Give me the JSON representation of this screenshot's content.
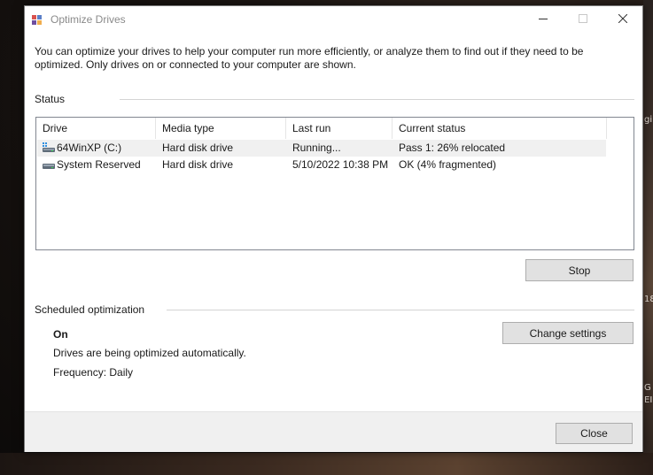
{
  "window": {
    "title": "Optimize Drives"
  },
  "description": "You can optimize your drives to help your computer run more efficiently, or analyze them to find out if they need to be optimized. Only drives on or connected to your computer are shown.",
  "status": {
    "section_label": "Status",
    "columns": [
      "Drive",
      "Media type",
      "Last run",
      "Current status"
    ],
    "rows": [
      {
        "drive": "64WinXP  (C:)",
        "icon": "windows-drive-icon",
        "media_type": "Hard disk drive",
        "last_run": "Running...",
        "current_status": "Pass 1: 26% relocated",
        "selected": true
      },
      {
        "drive": "System Reserved",
        "icon": "hard-drive-icon",
        "media_type": "Hard disk drive",
        "last_run": "5/10/2022 10:38 PM",
        "current_status": "OK (4% fragmented)",
        "selected": false
      }
    ],
    "stop_label": "Stop"
  },
  "scheduled": {
    "section_label": "Scheduled optimization",
    "state": "On",
    "message": "Drives are being optimized automatically.",
    "frequency": "Frequency: Daily",
    "change_label": "Change settings"
  },
  "footer": {
    "close_label": "Close"
  },
  "desktop": {
    "fragments": [
      "gi",
      "18",
      "G",
      "EI"
    ]
  }
}
